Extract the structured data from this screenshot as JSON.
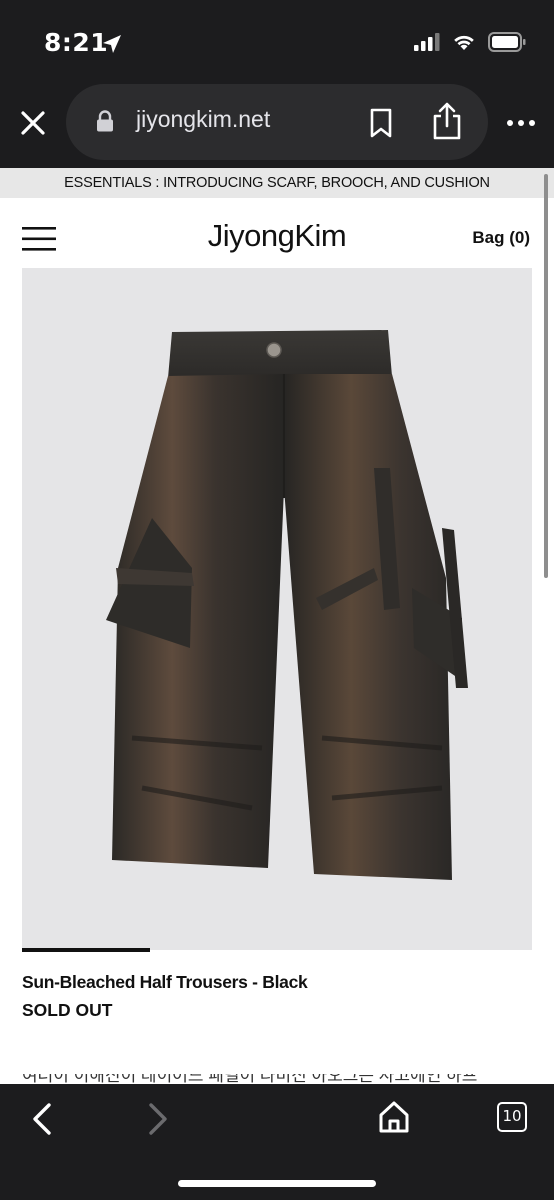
{
  "status_bar": {
    "time": "8:21",
    "icons": [
      "location-arrow-icon",
      "signal-icon",
      "wifi-icon",
      "battery-icon"
    ]
  },
  "browser": {
    "url": "jiyongkim.net",
    "icons": [
      "close-icon",
      "lock-icon",
      "bookmark-icon",
      "share-icon",
      "more-icon"
    ]
  },
  "site": {
    "announcement": "ESSENTIALS : INTRODUCING SCARF, BROOCH, AND CUSHION",
    "brand": "JiyongKim",
    "bag": "Bag (0)"
  },
  "product": {
    "title": "Sun-Bleached Half Trousers - Black",
    "status": "SOLD OUT",
    "description_partial": "여러이 이해진이 레이어드 패널이 라비진 아오그은 사고에인 하프",
    "gallery_progress_fraction": 0.25
  },
  "bottom_bar": {
    "tab_count": "10",
    "icons": [
      "back-icon",
      "forward-icon",
      "home-icon",
      "tabs-icon"
    ]
  },
  "colors": {
    "chrome_bg": "#1c1c1e",
    "url_pill": "#2c2c2e",
    "announce_bg": "#e7e7e7",
    "image_bg": "#e5e5e7"
  }
}
